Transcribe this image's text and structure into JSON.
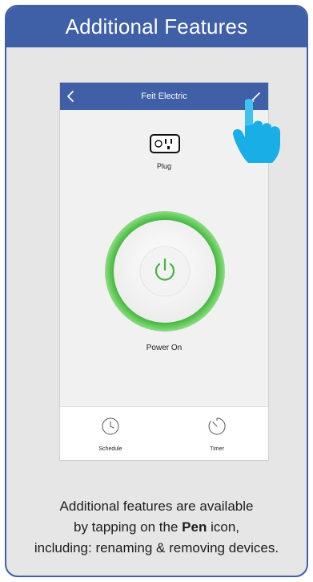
{
  "card": {
    "title": "Additional Features"
  },
  "app": {
    "nav_title": "Feit Electric",
    "device_label": "Plug",
    "power_status": "Power On",
    "tabs": [
      {
        "label": "Schedule",
        "icon": "clock-icon"
      },
      {
        "label": "Timer",
        "icon": "timer-icon"
      }
    ]
  },
  "caption": {
    "line1": "Additional features are available",
    "line2_prefix": "by tapping on the ",
    "line2_bold": "Pen",
    "line2_suffix": " icon,",
    "line3": "including: renaming & removing devices."
  },
  "colors": {
    "brand_blue": "#3f5fa6",
    "power_green": "#4fb94a",
    "hand_blue": "#1aaee6"
  }
}
